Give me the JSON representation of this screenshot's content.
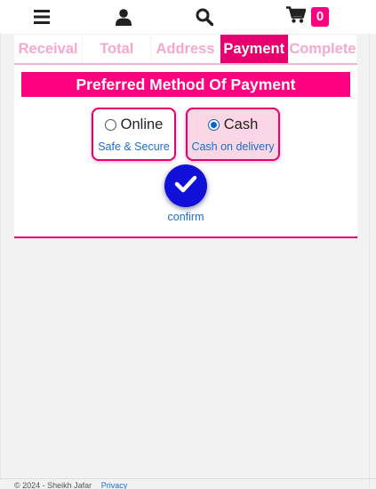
{
  "header": {
    "menu_icon": "bars-icon",
    "account_icon": "user-icon",
    "search_icon": "search-icon",
    "cart_icon": "shopping-cart-icon",
    "cart_count": "0"
  },
  "steps": {
    "tabs": [
      {
        "label": "Receival",
        "active": false
      },
      {
        "label": "Total",
        "active": false
      },
      {
        "label": "Address",
        "active": false
      },
      {
        "label": "Payment",
        "active": true
      },
      {
        "label": "Complete",
        "active": false
      }
    ]
  },
  "payment": {
    "title": "Preferred Method Of Payment",
    "options": [
      {
        "label": "Online",
        "sublabel": "Safe & Secure",
        "selected": false
      },
      {
        "label": "Cash",
        "sublabel": "Cash on delivery",
        "selected": true
      }
    ],
    "confirm_label": "confirm"
  },
  "footer": {
    "copyright": "© 2024 - Sheikh Jafar",
    "privacy_link": "Privacy"
  },
  "colors": {
    "accent": "#ff0080",
    "accent_dark": "#e6006e",
    "tab_inactive": "#f7a8cb",
    "selected_bg": "#fbd6e4",
    "confirm_button": "#1010d8",
    "link": "#1a6fcf"
  }
}
